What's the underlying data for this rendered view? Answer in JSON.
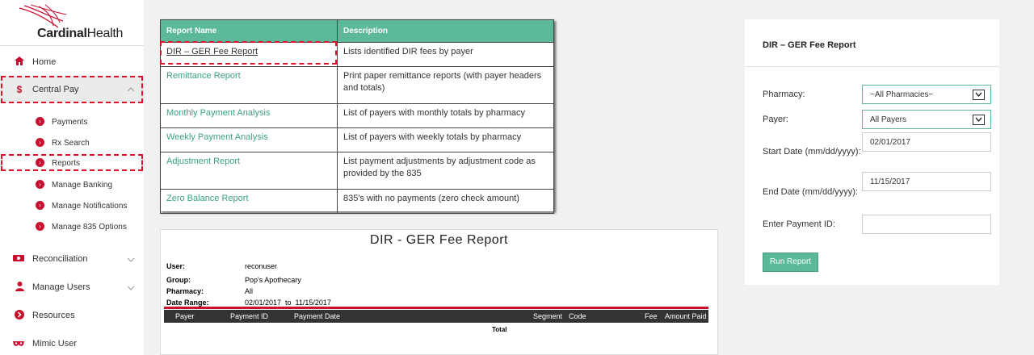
{
  "app": {
    "brand_bold": "Cardinal",
    "brand_light": "Health"
  },
  "sidebar": {
    "items": [
      {
        "label": "Home",
        "icon": "home-icon"
      },
      {
        "label": "Central Pay",
        "icon": "dollar-icon"
      },
      {
        "label": "Reconciliation",
        "icon": "money-icon"
      },
      {
        "label": "Manage Users",
        "icon": "user-icon"
      },
      {
        "label": "Resources",
        "icon": "arrow-circle-icon"
      },
      {
        "label": "Mimic User",
        "icon": "mask-icon"
      }
    ],
    "subitems": [
      {
        "label": "Payments"
      },
      {
        "label": "Rx Search"
      },
      {
        "label": "Reports"
      },
      {
        "label": "Manage Banking"
      },
      {
        "label": "Manage Notifications"
      },
      {
        "label": "Manage 835 Options"
      }
    ]
  },
  "reports_table": {
    "headers": [
      "Report Name",
      "Description"
    ],
    "rows": [
      {
        "name": "DIR – GER Fee Report",
        "desc": "Lists identified DIR fees by payer"
      },
      {
        "name": "Remittance Report",
        "desc": "Print paper remittance reports (with payer headers and totals)"
      },
      {
        "name": "Monthly Payment Analysis",
        "desc": "List of payers with monthly totals by pharmacy"
      },
      {
        "name": "Weekly Payment Analysis",
        "desc": "List of payers with weekly totals by pharmacy"
      },
      {
        "name": "Adjustment Report",
        "desc": "List payment adjustments by adjustment code as provided by the 835"
      },
      {
        "name": "Zero Balance Report",
        "desc": "835's with no payments (zero check amount)"
      }
    ]
  },
  "report_preview": {
    "title": "DIR - GER Fee Report",
    "user_label": "User:",
    "user_value": "reconuser",
    "group_label": "Group:",
    "group_value": "Pop's Apothecary",
    "pharmacy_label": "Pharmacy:",
    "pharmacy_value": "All",
    "range_label": "Date Range:",
    "range_value": "02/01/2017  to  11/15/2017",
    "columns": [
      "Payer",
      "Payment ID",
      "Payment Date",
      "Segment",
      "Code",
      "Fee",
      "Amount Paid"
    ],
    "total_label": "Total"
  },
  "form": {
    "title": "DIR – GER Fee Report",
    "pharmacy_label": "Pharmacy:",
    "pharmacy_value": "~All Pharmacies~",
    "payer_label": "Payer:",
    "payer_value": "All Payers",
    "start_label": "Start Date (mm/dd/yyyy):",
    "start_value": "02/01/2017",
    "end_label": "End Date (mm/dd/yyyy):",
    "end_value": "11/15/2017",
    "payment_id_label": "Enter Payment ID:",
    "payment_id_value": "",
    "run_label": "Run Report"
  },
  "colors": {
    "accent": "#5bb89b",
    "brand_red": "#c8102e",
    "highlight_dash": "#e0102a"
  }
}
